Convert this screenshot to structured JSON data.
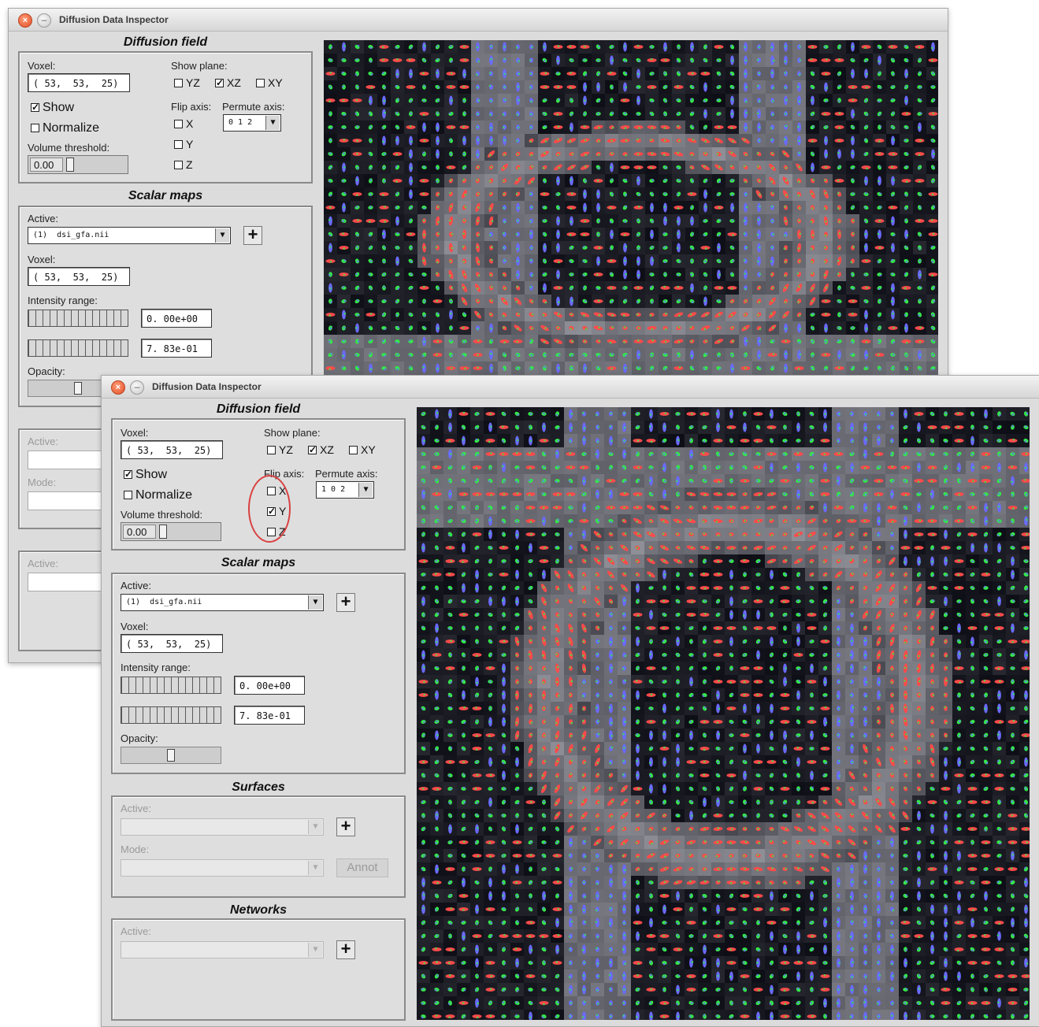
{
  "windows": [
    {
      "title": "Diffusion Data Inspector",
      "diffusion_field": {
        "title": "Diffusion field",
        "voxel_label": "Voxel:",
        "voxel_value": "( 53,  53,  25)",
        "show_label": "Show",
        "show_checked": true,
        "normalize_label": "Normalize",
        "normalize_checked": false,
        "volume_threshold_label": "Volume threshold:",
        "volume_threshold_value": "0.00",
        "show_plane_label": "Show plane:",
        "planes": [
          {
            "label": "YZ",
            "checked": false
          },
          {
            "label": "XZ",
            "checked": true
          },
          {
            "label": "XY",
            "checked": false
          }
        ],
        "flip_axis_label": "Flip axis:",
        "flip": [
          {
            "label": "X",
            "checked": false
          },
          {
            "label": "Y",
            "checked": false
          },
          {
            "label": "Z",
            "checked": false
          }
        ],
        "permute_axis_label": "Permute axis:",
        "permute_value": "0 1 2"
      },
      "scalar_maps": {
        "title": "Scalar maps",
        "active_label": "Active:",
        "active_value": "(1)  dsi_gfa.nii",
        "voxel_label": "Voxel:",
        "voxel_value": "( 53,  53,  25)",
        "intensity_range_label": "Intensity range:",
        "intensity_min": "0. 00e+00",
        "intensity_max": "7. 83e-01",
        "opacity_label": "Opacity:",
        "opacity": 0.5
      },
      "surfaces": {
        "active_label": "Active:",
        "mode_label": "Mode:"
      },
      "networks": {
        "active_label": "Active:"
      }
    },
    {
      "title": "Diffusion Data Inspector",
      "diffusion_field": {
        "title": "Diffusion field",
        "voxel_label": "Voxel:",
        "voxel_value": "( 53,  53,  25)",
        "show_label": "Show",
        "show_checked": true,
        "normalize_label": "Normalize",
        "normalize_checked": false,
        "volume_threshold_label": "Volume threshold:",
        "volume_threshold_value": "0.00",
        "show_plane_label": "Show plane:",
        "planes": [
          {
            "label": "YZ",
            "checked": false
          },
          {
            "label": "XZ",
            "checked": true
          },
          {
            "label": "XY",
            "checked": false
          }
        ],
        "flip_axis_label": "Flip axis:",
        "flip": [
          {
            "label": "X",
            "checked": false
          },
          {
            "label": "Y",
            "checked": true
          },
          {
            "label": "Z",
            "checked": false
          }
        ],
        "permute_axis_label": "Permute axis:",
        "permute_value": "1 0 2"
      },
      "scalar_maps": {
        "title": "Scalar maps",
        "active_label": "Active:",
        "active_value": "(1)  dsi_gfa.nii",
        "voxel_label": "Voxel:",
        "voxel_value": "( 53,  53,  25)",
        "intensity_range_label": "Intensity range:",
        "intensity_min": "0. 00e+00",
        "intensity_max": "7. 83e-01",
        "opacity_label": "Opacity:",
        "opacity": 0.5
      },
      "surfaces": {
        "title": "Surfaces",
        "active_label": "Active:",
        "mode_label": "Mode:",
        "annot_label": "Annot"
      },
      "networks": {
        "title": "Networks",
        "active_label": "Active:"
      }
    }
  ],
  "icons": {
    "close": "×",
    "minimize": "–",
    "dropdown": "▼",
    "add": "+"
  },
  "colors": {
    "window_bg": "#dcdcdc",
    "annotation_circle": "#d94040",
    "glyph_red": "#ff4a4a",
    "glyph_green": "#33e84a",
    "glyph_blue": "#6a6aff"
  }
}
